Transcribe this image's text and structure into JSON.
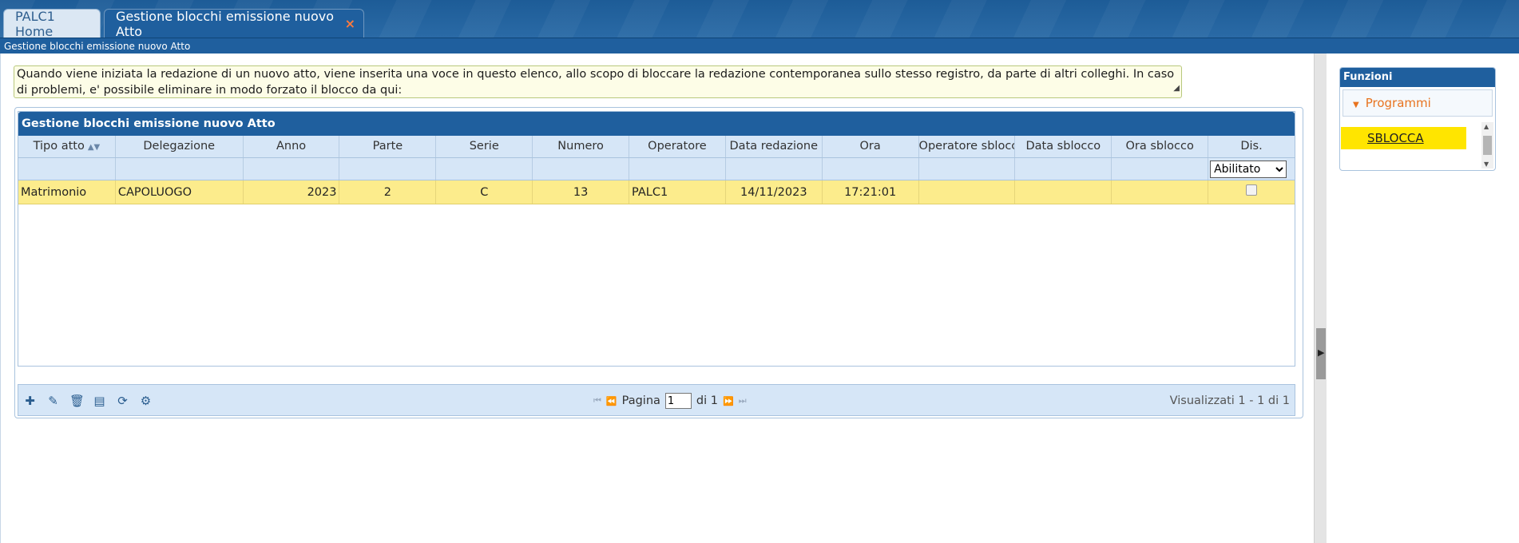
{
  "tabs": [
    {
      "label": "PALC1 Home",
      "active": false
    },
    {
      "label": "Gestione blocchi emissione nuovo Atto",
      "active": true,
      "close": "×"
    }
  ],
  "breadcrumb": "Gestione blocchi emissione nuovo Atto",
  "info_text": "Quando viene iniziata la redazione di un nuovo atto, viene inserita una voce in questo elenco, allo scopo di bloccare la redazione contemporanea sullo stesso registro, da parte di altri colleghi. In caso di problemi, e' possibile eliminare in modo forzato il blocco da qui:",
  "grid": {
    "title": "Gestione blocchi emissione nuovo Atto",
    "columns": [
      "Tipo atto",
      "Delegazione",
      "Anno",
      "Parte",
      "Serie",
      "Numero",
      "Operatore",
      "Data redazione",
      "Ora",
      "Operatore sblocco",
      "Data sblocco",
      "Ora sblocco",
      "Dis."
    ],
    "filter_dis": {
      "selected": "Abilitato"
    },
    "rows": [
      {
        "tipo": "Matrimonio",
        "delegazione": "CAPOLUOGO",
        "anno": "2023",
        "parte": "2",
        "serie": "C",
        "numero": "13",
        "operatore": "PALC1",
        "data": "14/11/2023",
        "ora": "17:21:01",
        "op_sblocco": "",
        "data_sblocco": "",
        "ora_sblocco": "",
        "dis": false
      }
    ]
  },
  "pager": {
    "label_page": "Pagina",
    "current": "1",
    "of_label": "di 1",
    "summary": "Visualizzati 1 - 1 di 1"
  },
  "side": {
    "title": "Funzioni",
    "group": "Programmi",
    "items": [
      "SBLOCCA"
    ]
  },
  "colors": {
    "primary": "#1f5f9e",
    "header": "#d6e6f7",
    "row_selected": "#fcec8c",
    "highlight": "#ffe500",
    "accent": "#e8731f"
  }
}
